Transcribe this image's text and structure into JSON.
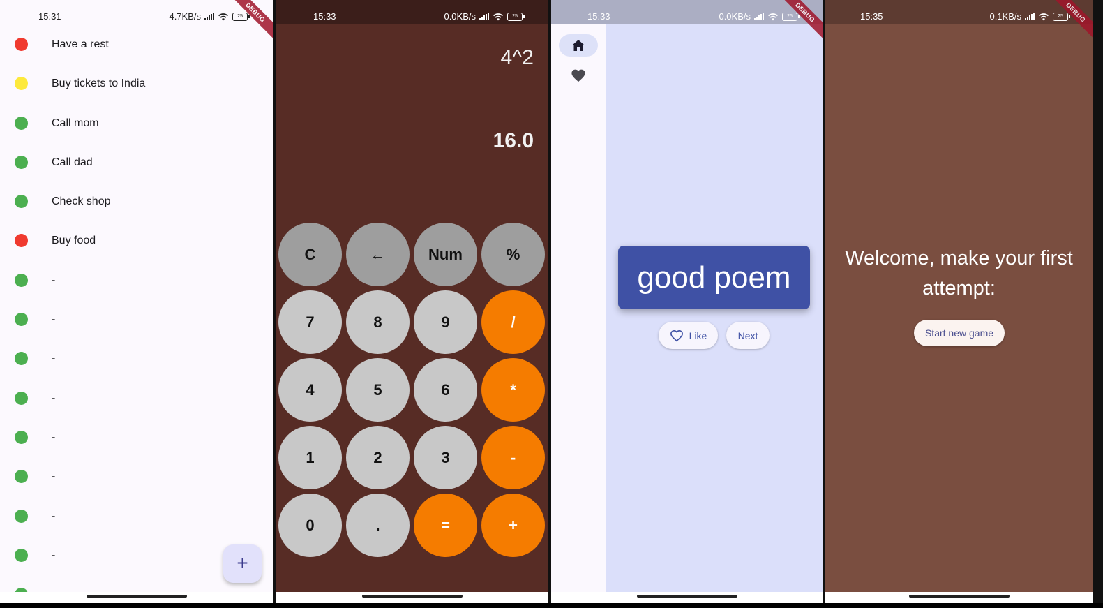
{
  "todo_app": {
    "status": {
      "time": "15:31",
      "speed": "4.7KB/s",
      "battery": "25"
    },
    "debug_banner": "DEBUG",
    "items": [
      {
        "label": "Have a rest",
        "color": "#f03a2f"
      },
      {
        "label": "Buy tickets to India",
        "color": "#fde93c"
      },
      {
        "label": "Call mom",
        "color": "#4caf50"
      },
      {
        "label": "Call dad",
        "color": "#4caf50"
      },
      {
        "label": "Check shop",
        "color": "#4caf50"
      },
      {
        "label": "Buy food",
        "color": "#f03a2f"
      },
      {
        "label": "-",
        "color": "#4caf50"
      },
      {
        "label": "-",
        "color": "#4caf50"
      },
      {
        "label": "-",
        "color": "#4caf50"
      },
      {
        "label": "-",
        "color": "#4caf50"
      },
      {
        "label": "-",
        "color": "#4caf50"
      },
      {
        "label": "-",
        "color": "#4caf50"
      },
      {
        "label": "-",
        "color": "#4caf50"
      },
      {
        "label": "-",
        "color": "#4caf50"
      },
      {
        "label": "",
        "color": "#4caf50"
      }
    ],
    "fab_icon": "+"
  },
  "calculator": {
    "status": {
      "time": "15:33",
      "speed": "0.0KB/s",
      "battery": "25"
    },
    "expression": "4^2",
    "result": "16.0",
    "keys": [
      {
        "label": "C",
        "type": "fn"
      },
      {
        "label": "←",
        "type": "fn"
      },
      {
        "label": "Num",
        "type": "fn"
      },
      {
        "label": "%",
        "type": "fn"
      },
      {
        "label": "7",
        "type": "num"
      },
      {
        "label": "8",
        "type": "num"
      },
      {
        "label": "9",
        "type": "num"
      },
      {
        "label": "/",
        "type": "op"
      },
      {
        "label": "4",
        "type": "num"
      },
      {
        "label": "5",
        "type": "num"
      },
      {
        "label": "6",
        "type": "num"
      },
      {
        "label": "*",
        "type": "op"
      },
      {
        "label": "1",
        "type": "num"
      },
      {
        "label": "2",
        "type": "num"
      },
      {
        "label": "3",
        "type": "num"
      },
      {
        "label": "-",
        "type": "op"
      },
      {
        "label": "0",
        "type": "num"
      },
      {
        "label": ".",
        "type": "num"
      },
      {
        "label": "=",
        "type": "op"
      },
      {
        "label": "+",
        "type": "op"
      }
    ]
  },
  "poem_app": {
    "status": {
      "time": "15:33",
      "speed": "0.0KB/s",
      "battery": "25"
    },
    "debug_banner": "DEBUG",
    "rail": {
      "home_icon": "home-icon",
      "favorites_icon": "heart-icon"
    },
    "word": "good poem",
    "like_label": "Like",
    "next_label": "Next"
  },
  "game_app": {
    "status": {
      "time": "15:35",
      "speed": "0.1KB/s",
      "battery": "25"
    },
    "debug_banner": "DEBUG",
    "welcome": "Welcome, make your first attempt:",
    "start_label": "Start new game"
  }
}
